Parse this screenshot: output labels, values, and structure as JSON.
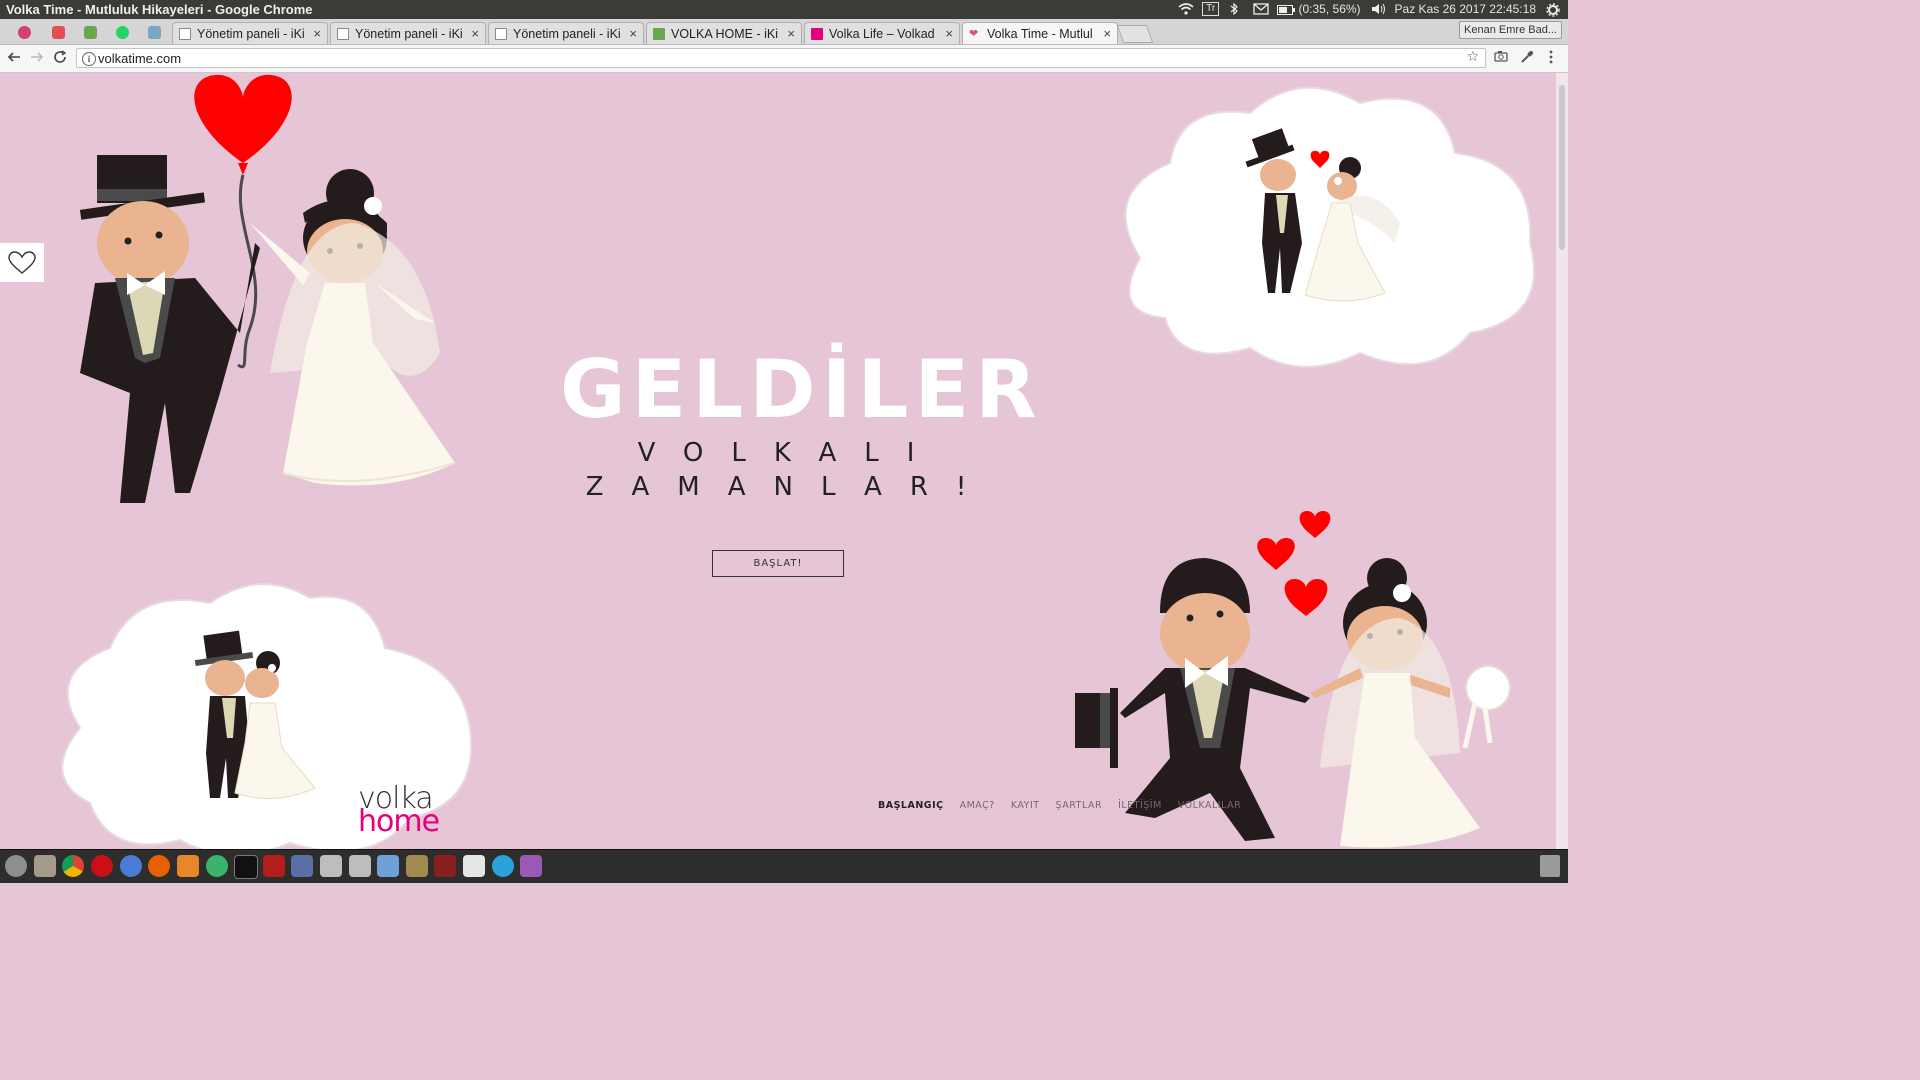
{
  "os": {
    "window_title": "Volka Time - Mutluluk Hikayeleri - Google Chrome",
    "input_method": "Tr",
    "battery": "(0:35, 56%)",
    "clock": "Paz Kas 26 2017 22:45:18"
  },
  "browser": {
    "tabs": [
      {
        "label": "Yönetim paneli - iKi"
      },
      {
        "label": "Yönetim paneli - iKi"
      },
      {
        "label": "Yönetim paneli - iKi"
      },
      {
        "label": "VOLKA HOME - iKi"
      },
      {
        "label": "Volka Life – Volkad"
      },
      {
        "label": "Volka Time - Mutlul"
      }
    ],
    "close_glyph": "×",
    "profile": "Kenan Emre Bad...",
    "url": "volkatime.com"
  },
  "page": {
    "hero_title": "GELDİLER",
    "hero_sub_line1": "VOLKALI",
    "hero_sub_line2": "ZAMANLAR!",
    "start_button": "BAŞLAT!",
    "logo_line1": "volka",
    "logo_line2": "home",
    "nav": [
      "BAŞLANGIÇ",
      "AMAÇ?",
      "KAYIT",
      "ŞARTLAR",
      "İLETİŞİM",
      "VOLKALILAR"
    ]
  },
  "colors": {
    "page_bg": "#e6c5d6",
    "heart_red": "#ff0000",
    "logo_pink": "#e6007e",
    "suit": "#241c1c",
    "dress": "#fbf7ec",
    "skin": "#e9b48f"
  }
}
